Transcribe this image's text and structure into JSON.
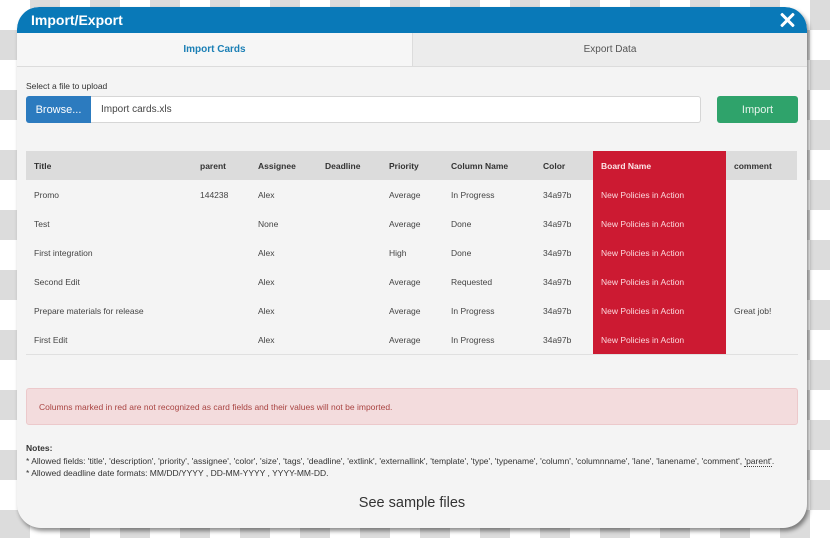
{
  "modal": {
    "title": "Import/Export",
    "close_icon": "close-icon"
  },
  "tabs": [
    {
      "label": "Import Cards",
      "active": true
    },
    {
      "label": "Export Data",
      "active": false
    }
  ],
  "upload": {
    "label": "Select a file to upload",
    "browse_label": "Browse...",
    "file_value": "Import cards.xls",
    "import_label": "Import"
  },
  "table": {
    "columns": [
      {
        "label": "Title",
        "unrecognized": false
      },
      {
        "label": "parent",
        "unrecognized": false
      },
      {
        "label": "Assignee",
        "unrecognized": false
      },
      {
        "label": "Deadline",
        "unrecognized": false
      },
      {
        "label": "Priority",
        "unrecognized": false
      },
      {
        "label": "Column Name",
        "unrecognized": false
      },
      {
        "label": "Color",
        "unrecognized": false
      },
      {
        "label": "Board Name",
        "unrecognized": true
      },
      {
        "label": "comment",
        "unrecognized": false
      }
    ],
    "rows": [
      [
        "Promo",
        "144238",
        "Alex",
        "",
        "Average",
        "In Progress",
        "34a97b",
        "New Policies in Action",
        ""
      ],
      [
        "Test",
        "",
        "None",
        "",
        "Average",
        "Done",
        "34a97b",
        "New Policies in Action",
        ""
      ],
      [
        "First integration",
        "",
        "Alex",
        "",
        "High",
        "Done",
        "34a97b",
        "New Policies in Action",
        ""
      ],
      [
        "Second Edit",
        "",
        "Alex",
        "",
        "Average",
        "Requested",
        "34a97b",
        "New Policies in Action",
        ""
      ],
      [
        "Prepare materials for release",
        "",
        "Alex",
        "",
        "Average",
        "In Progress",
        "34a97b",
        "New Policies in Action",
        "Great job!"
      ],
      [
        "First Edit",
        "",
        "Alex",
        "",
        "Average",
        "In Progress",
        "34a97b",
        "New Policies in Action",
        ""
      ]
    ]
  },
  "alert": {
    "text": "Columns marked in red are not recognized as card fields and their values will not be imported."
  },
  "notes": {
    "title": "Notes:",
    "fields_prefix": "* Allowed fields: 'title', 'description', 'priority', 'assignee', 'color', 'size', 'tags', 'deadline', 'extlink', 'externallink', 'template', 'type', 'typename', 'column', 'columnname', 'lane', 'lanename', 'comment', ",
    "fields_last": "'parent'",
    "fields_suffix": ".",
    "date_formats": "* Allowed deadline date formats: MM/DD/YYYY , DD-MM-YYYY , YYYY-MM-DD."
  },
  "sample_link": "See sample files",
  "colors": {
    "header": "#0979b8",
    "browse": "#2c7bbf",
    "import": "#2fa36b",
    "unrecognized": "#cc1a32",
    "alert_bg": "#f3dcdd",
    "alert_text": "#a94442"
  }
}
